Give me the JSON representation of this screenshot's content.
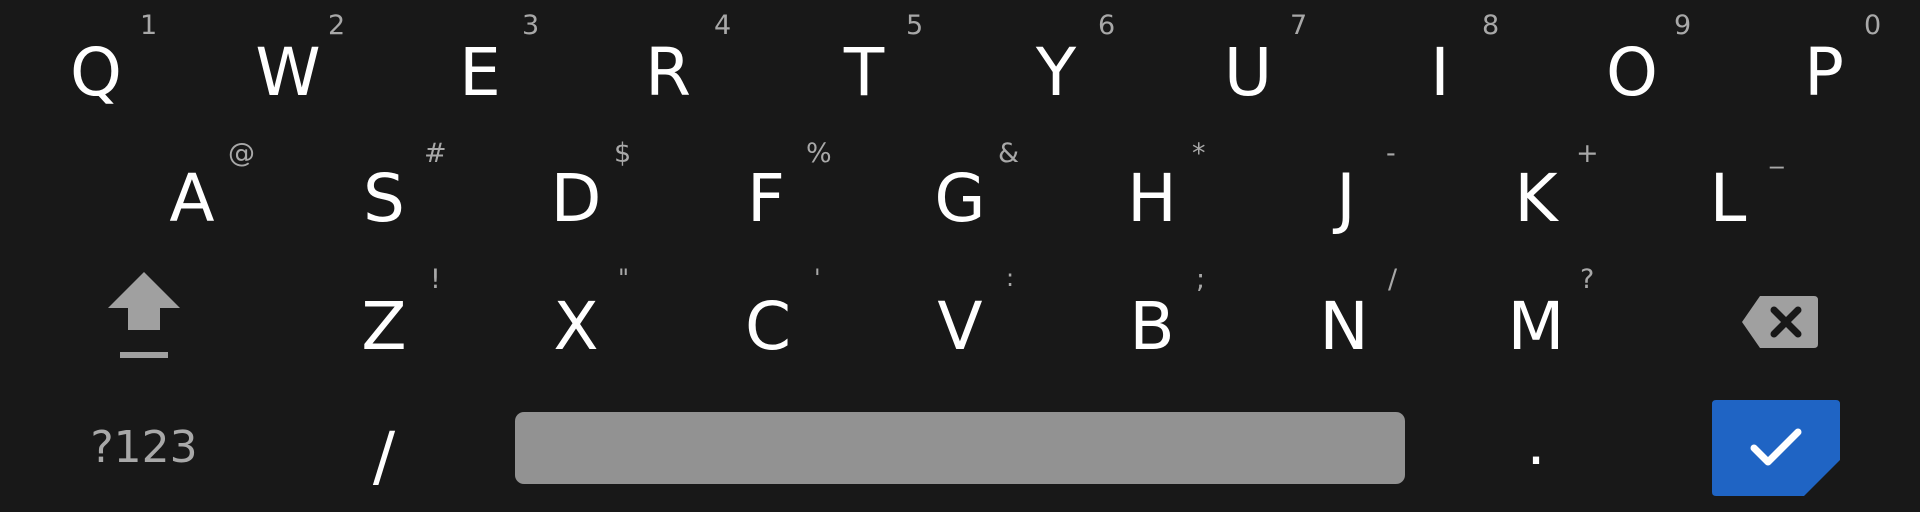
{
  "colors": {
    "background": "#181818",
    "key_text": "#ffffff",
    "hint_text": "#a8a8a8",
    "spacebar": "#929292",
    "enter_key": "#1f64c4",
    "icon_gray": "#a0a0a0"
  },
  "keyboard": {
    "row1": [
      {
        "letter": "Q",
        "hint": "1"
      },
      {
        "letter": "W",
        "hint": "2"
      },
      {
        "letter": "E",
        "hint": "3"
      },
      {
        "letter": "R",
        "hint": "4"
      },
      {
        "letter": "T",
        "hint": "5"
      },
      {
        "letter": "Y",
        "hint": "6"
      },
      {
        "letter": "U",
        "hint": "7"
      },
      {
        "letter": "I",
        "hint": "8"
      },
      {
        "letter": "O",
        "hint": "9"
      },
      {
        "letter": "P",
        "hint": "0"
      }
    ],
    "row2": [
      {
        "letter": "A",
        "hint": "@"
      },
      {
        "letter": "S",
        "hint": "#"
      },
      {
        "letter": "D",
        "hint": "$"
      },
      {
        "letter": "F",
        "hint": "%"
      },
      {
        "letter": "G",
        "hint": "&"
      },
      {
        "letter": "H",
        "hint": "*"
      },
      {
        "letter": "J",
        "hint": "-"
      },
      {
        "letter": "K",
        "hint": "+"
      },
      {
        "letter": "L",
        "hint": "_"
      }
    ],
    "row3": [
      {
        "letter": "Z",
        "hint": "!"
      },
      {
        "letter": "X",
        "hint": "\""
      },
      {
        "letter": "C",
        "hint": "'"
      },
      {
        "letter": "V",
        "hint": ":"
      },
      {
        "letter": "B",
        "hint": ";"
      },
      {
        "letter": "N",
        "hint": "/"
      },
      {
        "letter": "M",
        "hint": "?"
      }
    ],
    "shift_icon": "shift-arrow-icon",
    "delete_icon": "backspace-icon",
    "symbols_label": "?123",
    "slash_label": "/",
    "period_label": ".",
    "enter_icon": "checkmark-icon"
  }
}
